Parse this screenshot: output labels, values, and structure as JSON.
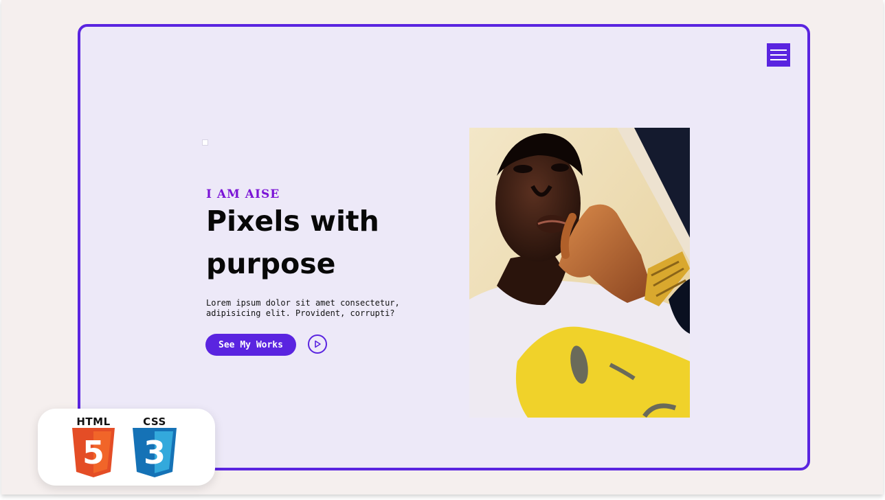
{
  "hero": {
    "eyebrow": "I AM AISE",
    "headline": "Pixels with purpose",
    "description": "Lorem ipsum dolor sit amet consectetur, adipisicing elit. Provident, corrupti?",
    "cta_label": "See My Works",
    "play_icon": "play-circle-icon"
  },
  "nav": {
    "menu_icon": "hamburger-icon"
  },
  "badges": {
    "html_label": "HTML",
    "html_number": "5",
    "css_label": "CSS",
    "css_number": "3"
  },
  "colors": {
    "accent": "#5a24e0",
    "eyebrow": "#7a14d6",
    "frame_bg": "#ede9f8",
    "page_bg": "#f5efee",
    "html_orange": "#e44d26",
    "css_blue": "#1572b6"
  }
}
